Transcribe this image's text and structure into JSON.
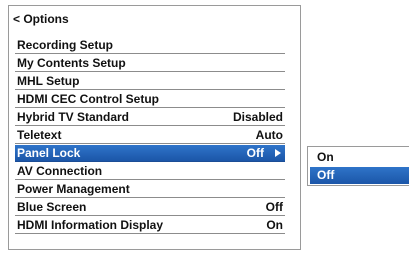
{
  "header": {
    "back_label": "< Options"
  },
  "menu": {
    "items": [
      {
        "label": "Recording Setup",
        "value": ""
      },
      {
        "label": "My Contents Setup",
        "value": ""
      },
      {
        "label": "MHL Setup",
        "value": ""
      },
      {
        "label": "HDMI CEC Control Setup",
        "value": ""
      },
      {
        "label": "Hybrid TV Standard",
        "value": "Disabled"
      },
      {
        "label": "Teletext",
        "value": "Auto"
      },
      {
        "label": "Panel Lock",
        "value": "Off"
      },
      {
        "label": "AV Connection",
        "value": ""
      },
      {
        "label": "Power Management",
        "value": ""
      },
      {
        "label": "Blue Screen",
        "value": "Off"
      },
      {
        "label": "HDMI Information Display",
        "value": "On"
      }
    ],
    "selected_index": 6
  },
  "submenu": {
    "options": [
      "On",
      "Off"
    ],
    "selected": "Off"
  },
  "colors": {
    "highlight": "#1f5fb4",
    "text": "#111111",
    "divider": "#8c8c8c",
    "background": "#ffffff"
  },
  "icons": {
    "selected_item_indicator": "triangle-right-icon"
  }
}
